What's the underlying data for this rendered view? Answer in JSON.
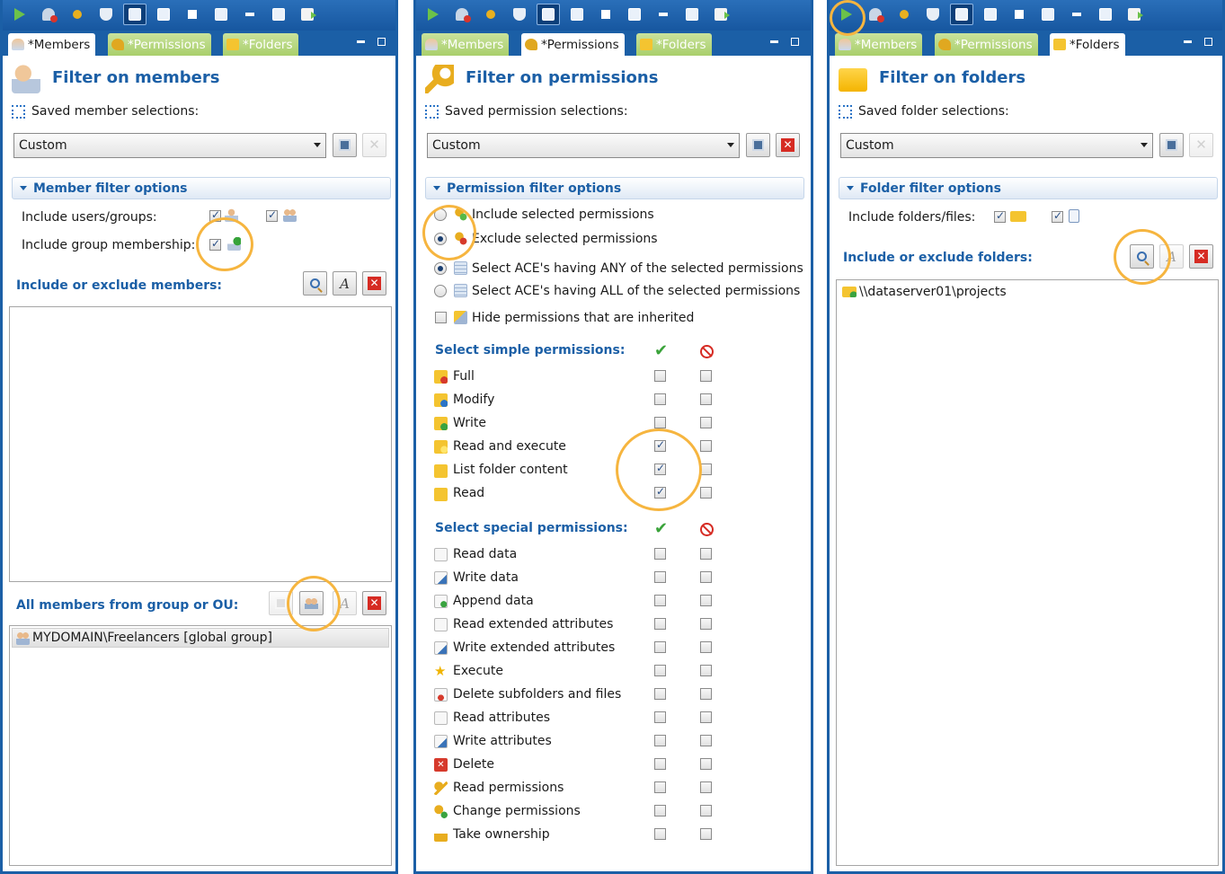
{
  "panels": [
    {
      "tabs": [
        {
          "label": "*Members",
          "icon": "members-icon",
          "active": true
        },
        {
          "label": "*Permissions",
          "icon": "key-icon",
          "active": false
        },
        {
          "label": "*Folders",
          "icon": "folder-icon",
          "active": false
        }
      ],
      "title": "Filter on members",
      "saved_label": "Saved member selections:",
      "selection": "Custom",
      "section": "Member filter options",
      "include_users_label": "Include users/groups:",
      "include_membership_label": "Include group membership:",
      "include_exclude_label": "Include or exclude members:",
      "group_ou_label": "All members from group or OU:",
      "group_items": [
        "MYDOMAIN\\Freelancers [global group]"
      ]
    },
    {
      "tabs": [
        {
          "label": "*Members",
          "icon": "members-icon",
          "active": false
        },
        {
          "label": "*Permissions",
          "icon": "key-icon",
          "active": true
        },
        {
          "label": "*Folders",
          "icon": "folder-icon",
          "active": false
        }
      ],
      "title": "Filter on permissions",
      "saved_label": "Saved permission selections:",
      "selection": "Custom",
      "section": "Permission filter options",
      "options": [
        {
          "label": "Include selected permissions",
          "type": "radio",
          "checked": false
        },
        {
          "label": "Exclude selected permissions",
          "type": "radio",
          "checked": true
        },
        {
          "label": "Select ACE's having ANY of the selected permissions",
          "type": "radio",
          "checked": true
        },
        {
          "label": "Select ACE's having ALL of the selected permissions",
          "type": "radio",
          "checked": false
        },
        {
          "label": "Hide permissions that are inherited",
          "type": "checkbox",
          "checked": false
        }
      ],
      "simple_label": "Select simple permissions:",
      "simple": [
        {
          "label": "Full",
          "icon": "folder-full-icon",
          "allow": false,
          "deny": false
        },
        {
          "label": "Modify",
          "icon": "folder-modify-icon",
          "allow": false,
          "deny": false
        },
        {
          "label": "Write",
          "icon": "folder-write-icon",
          "allow": false,
          "deny": false
        },
        {
          "label": "Read and execute",
          "icon": "folder-read-execute-icon",
          "allow": true,
          "deny": false
        },
        {
          "label": "List folder content",
          "icon": "folder-list-icon",
          "allow": true,
          "deny": false
        },
        {
          "label": "Read",
          "icon": "folder-read-icon",
          "allow": true,
          "deny": false
        }
      ],
      "special_label": "Select special permissions:",
      "special": [
        {
          "label": "Read data",
          "icon": "page-icon",
          "allow": false,
          "deny": false
        },
        {
          "label": "Write data",
          "icon": "page-edit-icon",
          "allow": false,
          "deny": false
        },
        {
          "label": "Append data",
          "icon": "page-add-icon",
          "allow": false,
          "deny": false
        },
        {
          "label": "Read extended attributes",
          "icon": "page-icon",
          "allow": false,
          "deny": false
        },
        {
          "label": "Write extended attributes",
          "icon": "page-edit-icon",
          "allow": false,
          "deny": false
        },
        {
          "label": "Execute",
          "icon": "star-icon",
          "allow": false,
          "deny": false
        },
        {
          "label": "Delete subfolders and files",
          "icon": "page-delete-icon",
          "allow": false,
          "deny": false
        },
        {
          "label": "Read attributes",
          "icon": "page-icon",
          "allow": false,
          "deny": false
        },
        {
          "label": "Write attributes",
          "icon": "page-edit-icon",
          "allow": false,
          "deny": false
        },
        {
          "label": "Delete",
          "icon": "delete-icon",
          "allow": false,
          "deny": false
        },
        {
          "label": "Read permissions",
          "icon": "key-icon",
          "allow": false,
          "deny": false
        },
        {
          "label": "Change permissions",
          "icon": "key-change-icon",
          "allow": false,
          "deny": false
        },
        {
          "label": "Take ownership",
          "icon": "lock-icon",
          "allow": false,
          "deny": false
        }
      ]
    },
    {
      "tabs": [
        {
          "label": "*Members",
          "icon": "members-icon",
          "active": false
        },
        {
          "label": "*Permissions",
          "icon": "key-icon",
          "active": false
        },
        {
          "label": "*Folders",
          "icon": "folder-icon",
          "active": true
        }
      ],
      "title": "Filter on folders",
      "saved_label": "Saved folder selections:",
      "selection": "Custom",
      "section": "Folder filter options",
      "include_label": "Include folders/files:",
      "include_exclude_label": "Include or exclude folders:",
      "folder_items": [
        "\\\\dataserver01\\projects"
      ]
    }
  ],
  "colors": {
    "accent": "#1b5fa6",
    "highlight": "#f6b53f",
    "tab_inactive": "#a9cf6b"
  }
}
